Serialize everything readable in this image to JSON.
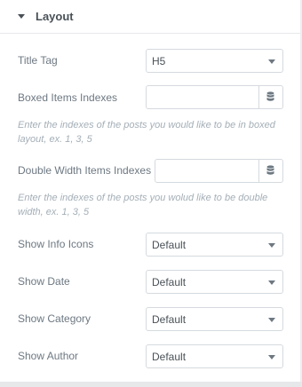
{
  "section": {
    "title": "Layout",
    "toggle_icon": "caret-down-icon"
  },
  "fields": {
    "title_tag": {
      "label": "Title Tag",
      "value": "H5"
    },
    "boxed_items": {
      "label": "Boxed Items Indexes",
      "value": "",
      "icon": "database-icon",
      "description": "Enter the indexes of the posts you would like to be in boxed layout, ex. 1, 3, 5"
    },
    "double_width": {
      "label": "Double Width Items Indexes",
      "value": "",
      "icon": "database-icon",
      "description": "Enter the indexes of the posts you wolud like to be double width, ex. 1, 3, 5"
    },
    "show_info_icons": {
      "label": "Show Info Icons",
      "value": "Default"
    },
    "show_date": {
      "label": "Show Date",
      "value": "Default"
    },
    "show_category": {
      "label": "Show Category",
      "value": "Default"
    },
    "show_author": {
      "label": "Show Author",
      "value": "Default"
    }
  }
}
